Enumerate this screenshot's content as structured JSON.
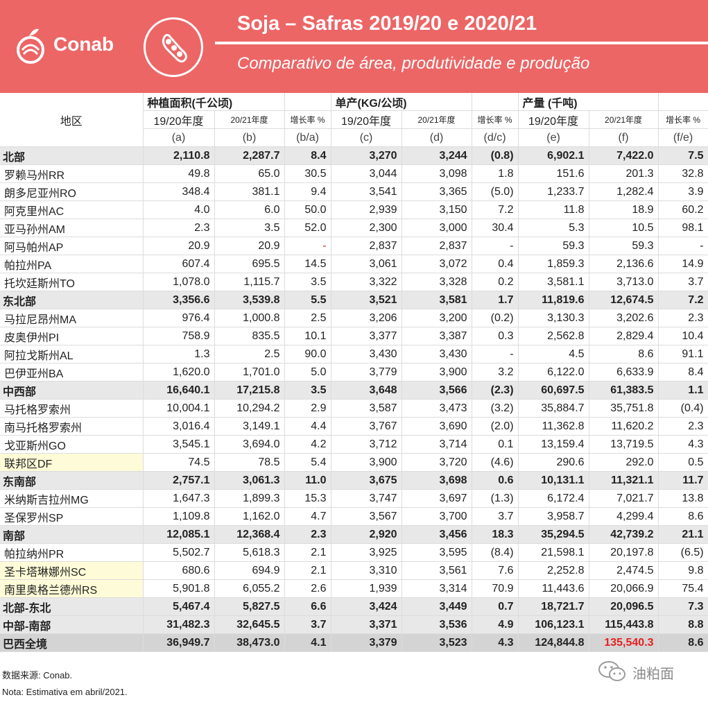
{
  "header": {
    "brand": "Conab",
    "title": "Soja – Safras 2019/20 e 2020/21",
    "subtitle": "Comparativo de área, produtividade e produção",
    "bg_color": "#ec6666",
    "icon": "soybean-pod-icon"
  },
  "table": {
    "region_header": "地区",
    "groups": [
      "种植面积(千公顷)",
      "单产(KG/公顷)",
      "产量 (千吨)"
    ],
    "sub_headers": [
      "19/20年度",
      "20/21年度",
      "增长率 %",
      "19/20年度",
      "20/21年度",
      "增长率 %",
      "19/20年度",
      "20/21年度",
      "增长率 %"
    ],
    "letters": [
      "(a)",
      "(b)",
      "(b/a)",
      "(c)",
      "(d)",
      "(d/c)",
      "(e)",
      "(f)",
      "(f/e)"
    ],
    "rows": [
      {
        "name": "北部",
        "v": [
          "2,110.8",
          "2,287.7",
          "8.4",
          "3,270",
          "3,244",
          "(0.8)",
          "6,902.1",
          "7,422.0",
          "7.5"
        ]
      },
      {
        "name": "罗赖马州RR",
        "v": [
          "49.8",
          "65.0",
          "30.5",
          "3,044",
          "3,098",
          "1.8",
          "151.6",
          "201.3",
          "32.8"
        ]
      },
      {
        "name": "朗多尼亚州RO",
        "v": [
          "348.4",
          "381.1",
          "9.4",
          "3,541",
          "3,365",
          "(5.0)",
          "1,233.7",
          "1,282.4",
          "3.9"
        ]
      },
      {
        "name": "阿克里州AC",
        "v": [
          "4.0",
          "6.0",
          "50.0",
          "2,939",
          "3,150",
          "7.2",
          "11.8",
          "18.9",
          "60.2"
        ]
      },
      {
        "name": "亚马孙州AM",
        "v": [
          "2.3",
          "3.5",
          "52.0",
          "2,300",
          "3,000",
          "30.4",
          "5.3",
          "10.5",
          "98.1"
        ]
      },
      {
        "name": "阿马帕州AP",
        "v": [
          "20.9",
          "20.9",
          "-",
          "2,837",
          "2,837",
          "-",
          "59.3",
          "59.3",
          "-"
        ]
      },
      {
        "name": "帕拉州PA",
        "v": [
          "607.4",
          "695.5",
          "14.5",
          "3,061",
          "3,072",
          "0.4",
          "1,859.3",
          "2,136.6",
          "14.9"
        ]
      },
      {
        "name": "托坎廷斯州TO",
        "v": [
          "1,078.0",
          "1,115.7",
          "3.5",
          "3,322",
          "3,328",
          "0.2",
          "3,581.1",
          "3,713.0",
          "3.7"
        ]
      },
      {
        "name": "东北部",
        "v": [
          "3,356.6",
          "3,539.8",
          "5.5",
          "3,521",
          "3,581",
          "1.7",
          "11,819.6",
          "12,674.5",
          "7.2"
        ]
      },
      {
        "name": "马拉尼昂州MA",
        "v": [
          "976.4",
          "1,000.8",
          "2.5",
          "3,206",
          "3,200",
          "(0.2)",
          "3,130.3",
          "3,202.6",
          "2.3"
        ]
      },
      {
        "name": "皮奥伊州PI",
        "v": [
          "758.9",
          "835.5",
          "10.1",
          "3,377",
          "3,387",
          "0.3",
          "2,562.8",
          "2,829.4",
          "10.4"
        ]
      },
      {
        "name": "阿拉戈斯州AL",
        "v": [
          "1.3",
          "2.5",
          "90.0",
          "3,430",
          "3,430",
          "-",
          "4.5",
          "8.6",
          "91.1"
        ]
      },
      {
        "name": "巴伊亚州BA",
        "v": [
          "1,620.0",
          "1,701.0",
          "5.0",
          "3,779",
          "3,900",
          "3.2",
          "6,122.0",
          "6,633.9",
          "8.4"
        ]
      },
      {
        "name": "中西部",
        "v": [
          "16,640.1",
          "17,215.8",
          "3.5",
          "3,648",
          "3,566",
          "(2.3)",
          "60,697.5",
          "61,383.5",
          "1.1"
        ]
      },
      {
        "name": "马托格罗索州",
        "v": [
          "10,004.1",
          "10,294.2",
          "2.9",
          "3,587",
          "3,473",
          "(3.2)",
          "35,884.7",
          "35,751.8",
          "(0.4)"
        ]
      },
      {
        "name": "南马托格罗索州",
        "v": [
          "3,016.4",
          "3,149.1",
          "4.4",
          "3,767",
          "3,690",
          "(2.0)",
          "11,362.8",
          "11,620.2",
          "2.3"
        ]
      },
      {
        "name": "戈亚斯州GO",
        "v": [
          "3,545.1",
          "3,694.0",
          "4.2",
          "3,712",
          "3,714",
          "0.1",
          "13,159.4",
          "13,719.5",
          "4.3"
        ]
      },
      {
        "name": "联邦区DF",
        "v": [
          "74.5",
          "78.5",
          "5.4",
          "3,900",
          "3,720",
          "(4.6)",
          "290.6",
          "292.0",
          "0.5"
        ]
      },
      {
        "name": "东南部",
        "v": [
          "2,757.1",
          "3,061.3",
          "11.0",
          "3,675",
          "3,698",
          "0.6",
          "10,131.1",
          "11,321.1",
          "11.7"
        ]
      },
      {
        "name": "米纳斯吉拉州MG",
        "v": [
          "1,647.3",
          "1,899.3",
          "15.3",
          "3,747",
          "3,697",
          "(1.3)",
          "6,172.4",
          "7,021.7",
          "13.8"
        ]
      },
      {
        "name": "圣保罗州SP",
        "v": [
          "1,109.8",
          "1,162.0",
          "4.7",
          "3,567",
          "3,700",
          "3.7",
          "3,958.7",
          "4,299.4",
          "8.6"
        ]
      },
      {
        "name": "南部",
        "v": [
          "12,085.1",
          "12,368.4",
          "2.3",
          "2,920",
          "3,456",
          "18.3",
          "35,294.5",
          "42,739.2",
          "21.1"
        ]
      },
      {
        "name": "帕拉纳州PR",
        "v": [
          "5,502.7",
          "5,618.3",
          "2.1",
          "3,925",
          "3,595",
          "(8.4)",
          "21,598.1",
          "20,197.8",
          "(6.5)"
        ]
      },
      {
        "name": "圣卡塔琳娜州SC",
        "v": [
          "680.6",
          "694.9",
          "2.1",
          "3,310",
          "3,561",
          "7.6",
          "2,252.8",
          "2,474.5",
          "9.8"
        ]
      },
      {
        "name": "南里奥格兰德州RS",
        "v": [
          "5,901.8",
          "6,055.2",
          "2.6",
          "1,939",
          "3,314",
          "70.9",
          "11,443.6",
          "20,066.9",
          "75.4"
        ]
      },
      {
        "name": "北部-东北",
        "v": [
          "5,467.4",
          "5,827.5",
          "6.6",
          "3,424",
          "3,449",
          "0.7",
          "18,721.7",
          "20,096.5",
          "7.3"
        ]
      },
      {
        "name": "中部-南部",
        "v": [
          "31,482.3",
          "32,645.5",
          "3.7",
          "3,371",
          "3,536",
          "4.9",
          "106,123.1",
          "115,443.8",
          "8.8"
        ]
      },
      {
        "name": "巴西全境",
        "v": [
          "36,949.7",
          "38,473.0",
          "4.1",
          "3,379",
          "3,523",
          "4.3",
          "124,844.8",
          "135,540.3",
          "8.6"
        ]
      }
    ]
  },
  "notes": {
    "source": "数据来源: Conab.",
    "nota": "Nota: Estimativa em abril/2021."
  },
  "watermark": {
    "text": "油粕面",
    "icon": "wechat-icon"
  },
  "colors": {
    "highlight_red": "#e52020",
    "highlight_yellow": "#fefcd8"
  }
}
